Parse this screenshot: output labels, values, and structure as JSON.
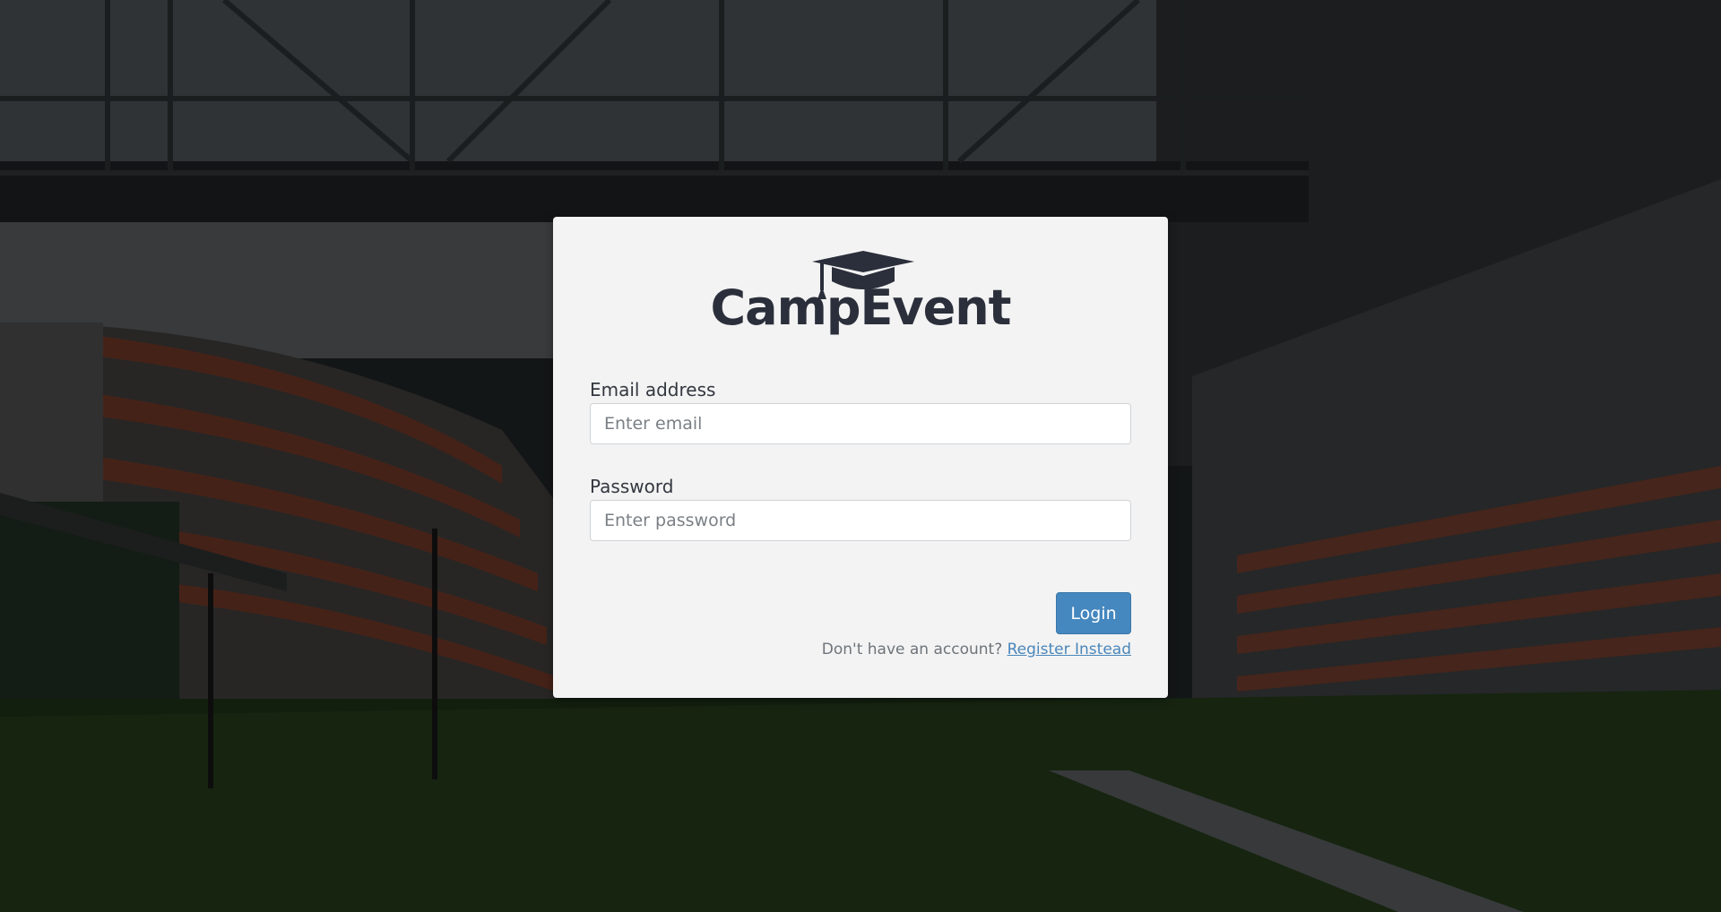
{
  "brand": {
    "name": "CampEvent",
    "logo_icon": "graduation-cap-icon",
    "text_color": "#2b2f3b"
  },
  "login_form": {
    "email_label": "Email address",
    "email_placeholder": "Enter email",
    "email_value": "",
    "password_label": "Password",
    "password_placeholder": "Enter password",
    "password_value": "",
    "login_button_label": "Login",
    "register_prompt": "Don't have an account?",
    "register_link_label": "Register Instead"
  },
  "colors": {
    "card_background": "#f3f3f3",
    "primary_button": "#4587bf",
    "link": "#4a86ba",
    "background_overlay": "#1e2224"
  },
  "background": {
    "description_icon": "campus-building-photo"
  }
}
